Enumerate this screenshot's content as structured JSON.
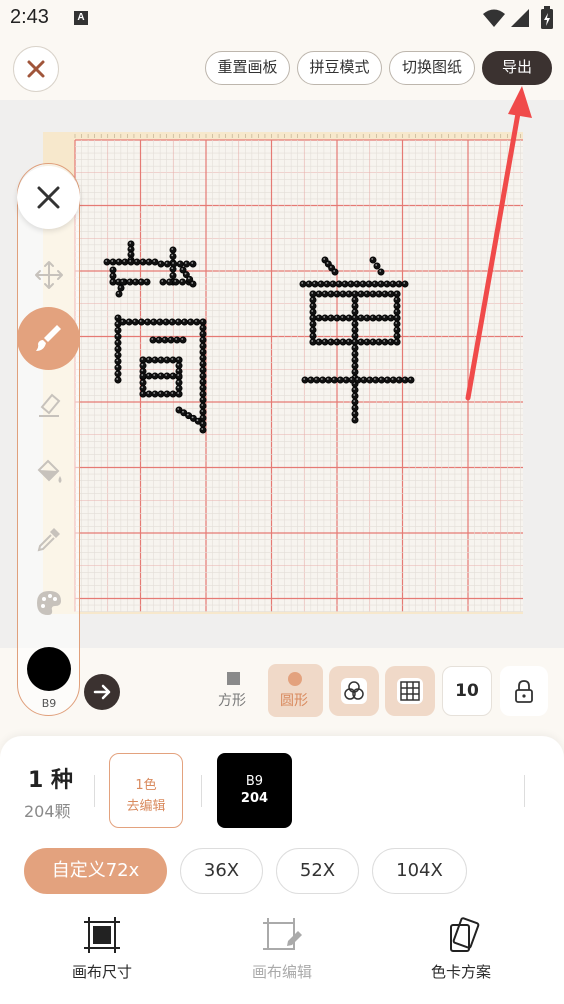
{
  "status_bar": {
    "time": "2:43",
    "notification_badge": "A"
  },
  "toolbar": {
    "reset_label": "重置画板",
    "bead_mode_label": "拼豆模式",
    "switch_pattern_label": "切换图纸",
    "export_label": "导出"
  },
  "style_options": {
    "square_label": "方形",
    "round_label": "圆形",
    "grid_number": "10"
  },
  "current_color": {
    "code": "B9",
    "hex": "#000000"
  },
  "summary": {
    "kinds": "1 种",
    "beads": "204颗",
    "edit_line1": "1色",
    "edit_line2": "去编辑",
    "swatch_code": "B9",
    "swatch_count": "204"
  },
  "sizes": [
    {
      "label": "自定义72x",
      "active": true
    },
    {
      "label": "36X",
      "active": false
    },
    {
      "label": "52X",
      "active": false
    },
    {
      "label": "104X",
      "active": false
    }
  ],
  "bottom_tabs": [
    {
      "label": "画布尺寸",
      "enabled": true
    },
    {
      "label": "画布编辑",
      "enabled": false
    },
    {
      "label": "色卡方案",
      "enabled": true
    }
  ],
  "colors": {
    "accent": "#e3a27e",
    "dark": "#3b3230",
    "grid_major": "#e57a74",
    "arrow": "#f04a4a"
  }
}
